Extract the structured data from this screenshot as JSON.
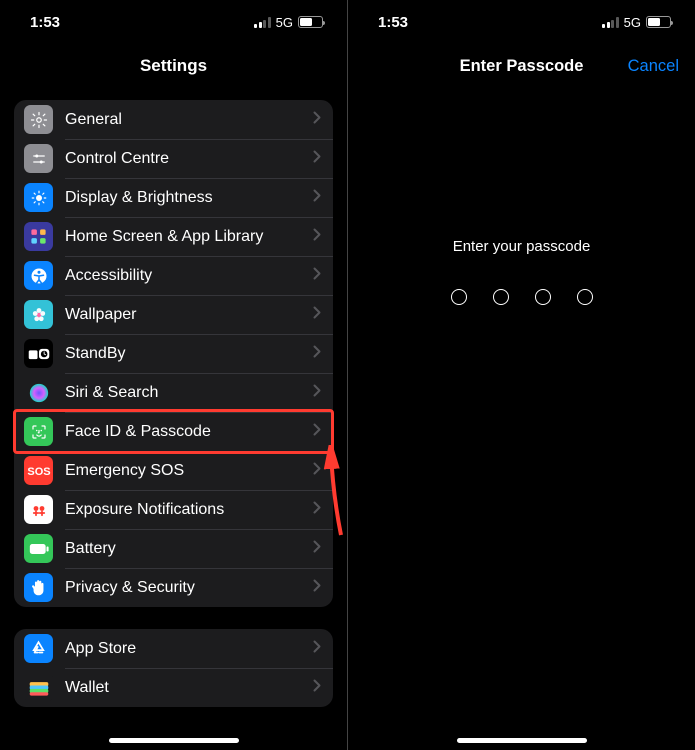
{
  "status": {
    "time": "1:53",
    "network": "5G",
    "bars_active": 2
  },
  "left": {
    "title": "Settings",
    "group1": [
      {
        "key": "general",
        "label": "General",
        "iconBg": "#8e8e93",
        "glyph": "gear"
      },
      {
        "key": "control-centre",
        "label": "Control Centre",
        "iconBg": "#8e8e93",
        "glyph": "sliders"
      },
      {
        "key": "display",
        "label": "Display & Brightness",
        "iconBg": "#0a84ff",
        "glyph": "brightness"
      },
      {
        "key": "home-screen",
        "label": "Home Screen & App Library",
        "iconBg": "#3a3a9f",
        "glyph": "grid"
      },
      {
        "key": "accessibility",
        "label": "Accessibility",
        "iconBg": "#0a84ff",
        "glyph": "access"
      },
      {
        "key": "wallpaper",
        "label": "Wallpaper",
        "iconBg": "#33c2d7",
        "glyph": "flower"
      },
      {
        "key": "standby",
        "label": "StandBy",
        "iconBg": "#000000",
        "glyph": "standby"
      },
      {
        "key": "siri",
        "label": "Siri & Search",
        "iconBg": "#1c1c1e",
        "glyph": "siri"
      },
      {
        "key": "faceid",
        "label": "Face ID & Passcode",
        "iconBg": "#34c759",
        "glyph": "faceid"
      },
      {
        "key": "sos",
        "label": "Emergency SOS",
        "iconBg": "#ff3b30",
        "glyph": "sos"
      },
      {
        "key": "exposure",
        "label": "Exposure Notifications",
        "iconBg": "#ffffff",
        "glyph": "exposure"
      },
      {
        "key": "battery",
        "label": "Battery",
        "iconBg": "#34c759",
        "glyph": "battery"
      },
      {
        "key": "privacy",
        "label": "Privacy & Security",
        "iconBg": "#0a84ff",
        "glyph": "hand"
      }
    ],
    "group2": [
      {
        "key": "appstore",
        "label": "App Store",
        "iconBg": "#0a84ff",
        "glyph": "appstore"
      },
      {
        "key": "wallet",
        "label": "Wallet",
        "iconBg": "#1c1c1e",
        "glyph": "wallet"
      }
    ]
  },
  "right": {
    "title": "Enter Passcode",
    "cancel": "Cancel",
    "prompt": "Enter your passcode",
    "dot_count": 4
  },
  "highlighted_item": "faceid"
}
